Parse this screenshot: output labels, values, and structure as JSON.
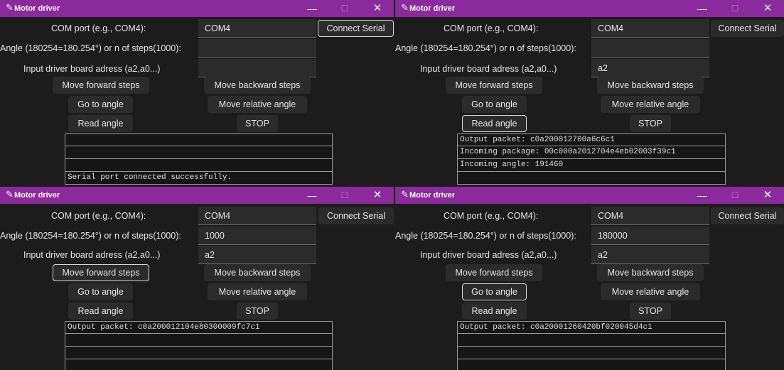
{
  "windows": [
    {
      "title": "Motor driver",
      "titlebar_controls": {
        "minimize": "—",
        "maximize": "☐",
        "close": "✕"
      },
      "com_port_label": "COM port (e.g., COM4):",
      "com_port_value": "COM4",
      "connect_label": "Connect Serial",
      "angle_label": "Angle (180254=180.254°) or n of steps(1000):",
      "angle_value": "",
      "address_label": "Input driver board adress (a2,a0...)",
      "address_value": "",
      "forward_label": "Move forward steps",
      "backward_label": "Move backward steps",
      "goto_label": "Go to angle",
      "relative_label": "Move relative angle",
      "read_label": "Read angle",
      "stop_label": "STOP",
      "focused_button": "connect",
      "log": [
        "",
        "",
        "",
        "Serial port connected successfully."
      ]
    },
    {
      "title": "Motor driver",
      "titlebar_controls": {
        "minimize": "—",
        "maximize": "☐",
        "close": "✕"
      },
      "com_port_label": "COM port (e.g., COM4):",
      "com_port_value": "COM4",
      "connect_label": "Connect Serial",
      "angle_label": "Angle (180254=180.254°) or n of steps(1000):",
      "angle_value": "",
      "address_label": "Input driver board adress (a2,a0...)",
      "address_value": "a2",
      "forward_label": "Move forward steps",
      "backward_label": "Move backward steps",
      "goto_label": "Go to angle",
      "relative_label": "Move relative angle",
      "read_label": "Read angle",
      "stop_label": "STOP",
      "focused_button": "read",
      "log": [
        "Output packet: c0a200012700a6c6c1",
        "Incoming package: 00c000a2012704e4eb02003f39c1",
        "Incoming angle: 191460",
        ""
      ]
    },
    {
      "title": "Motor driver",
      "titlebar_controls": {
        "minimize": "—",
        "maximize": "☐",
        "close": "✕"
      },
      "com_port_label": "COM port (e.g., COM4):",
      "com_port_value": "COM4",
      "connect_label": "Connect Serial",
      "angle_label": "Angle (180254=180.254°) or n of steps(1000):",
      "angle_value": "1000",
      "address_label": "Input driver board adress (a2,a0...)",
      "address_value": "a2",
      "forward_label": "Move forward steps",
      "backward_label": "Move backward steps",
      "goto_label": "Go to angle",
      "relative_label": "Move relative angle",
      "read_label": "Read angle",
      "stop_label": "STOP",
      "focused_button": "forward",
      "log": [
        "Output packet: c0a200012104e80300009fc7c1",
        "",
        "",
        ""
      ]
    },
    {
      "title": "Motor driver",
      "titlebar_controls": {
        "minimize": "—",
        "maximize": "☐",
        "close": "✕"
      },
      "com_port_label": "COM port (e.g., COM4):",
      "com_port_value": "COM4",
      "connect_label": "Connect Serial",
      "angle_label": "Angle (180254=180.254°) or n of steps(1000):",
      "angle_value": "180000",
      "address_label": "Input driver board adress (a2,a0...)",
      "address_value": "a2",
      "forward_label": "Move forward steps",
      "backward_label": "Move backward steps",
      "goto_label": "Go to angle",
      "relative_label": "Move relative angle",
      "read_label": "Read angle",
      "stop_label": "STOP",
      "focused_button": "goto",
      "log": [
        "Output packet: c0a20001260420bf020045d4c1",
        "",
        "",
        ""
      ]
    }
  ]
}
